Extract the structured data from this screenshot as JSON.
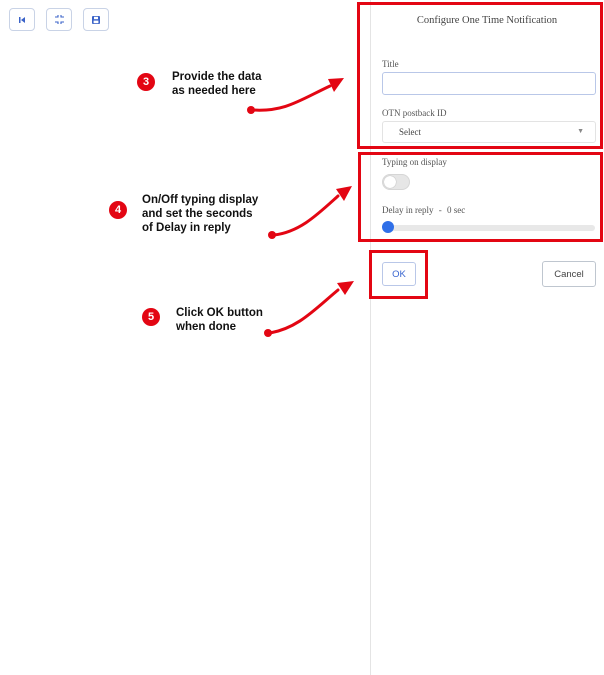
{
  "toolbar": {
    "icons": [
      "skip-back-icon",
      "fit-view-icon",
      "save-icon"
    ]
  },
  "panel": {
    "title": "Configure One Time Notification",
    "title_label": "Title",
    "title_value": "",
    "otn_label": "OTN postback ID",
    "otn_selected": "Select",
    "typing_label": "Typing on display",
    "typing_on": false,
    "delay_label": "Delay in reply",
    "delay_separator": "-",
    "delay_value": "0 sec",
    "ok_label": "OK",
    "cancel_label": "Cancel"
  },
  "callouts": [
    {
      "step": "3",
      "line1": "Provide the data",
      "line2": "as needed here",
      "line3": ""
    },
    {
      "step": "4",
      "line1": "On/Off typing display",
      "line2": "and set the seconds",
      "line3": "of Delay in reply"
    },
    {
      "step": "5",
      "line1": "Click OK button",
      "line2": "when done",
      "line3": ""
    }
  ],
  "colors": {
    "annotation": "#e30613",
    "accent": "#2f6fe8",
    "toolbar_icon": "#3b63c8"
  }
}
